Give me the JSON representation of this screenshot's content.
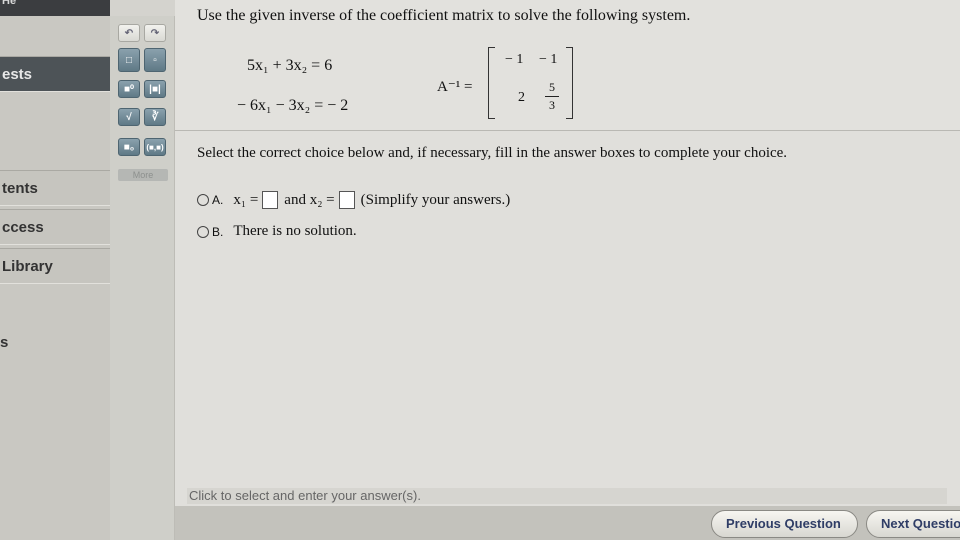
{
  "sidebar": {
    "top_fragment": "He",
    "items": [
      {
        "label": "ests",
        "active": true
      },
      {
        "label": "tents",
        "active": false
      },
      {
        "label": "ccess",
        "active": false
      },
      {
        "label": "Library",
        "active": false
      }
    ],
    "bottom_fragment": "s"
  },
  "palette": {
    "buttons": [
      "undo-icon",
      "redo-icon",
      "fraction-icon",
      "mixed-number-icon",
      "exponent-icon",
      "absolute-value-icon",
      "sqrt-icon",
      "nth-root-icon",
      "subscript-icon",
      "ordered-pair-icon"
    ],
    "more_label": "More"
  },
  "question": {
    "title": "Use the given inverse of the coefficient matrix to solve the following system.",
    "eq1": "5x₁ + 3x₂ = 6",
    "eq2": "− 6x₁ − 3x₂ = − 2",
    "ainv_label": "A⁻¹ =",
    "matrix": {
      "r1c1": "− 1",
      "r1c2": "− 1",
      "r2c1": "2",
      "r2c2_num": "5",
      "r2c2_den": "3"
    }
  },
  "instruction": "Select the correct choice below and, if necessary, fill in the answer boxes to complete your choice.",
  "choices": {
    "a_letter": "A.",
    "a_x1": "x₁ =",
    "a_and": "and x₂ =",
    "a_note": "(Simplify your answers.)",
    "b_letter": "B.",
    "b_text": "There is no solution."
  },
  "status_text": "Click to select and enter your answer(s).",
  "buttons": {
    "previous": "Previous Question",
    "next": "Next Questio"
  }
}
